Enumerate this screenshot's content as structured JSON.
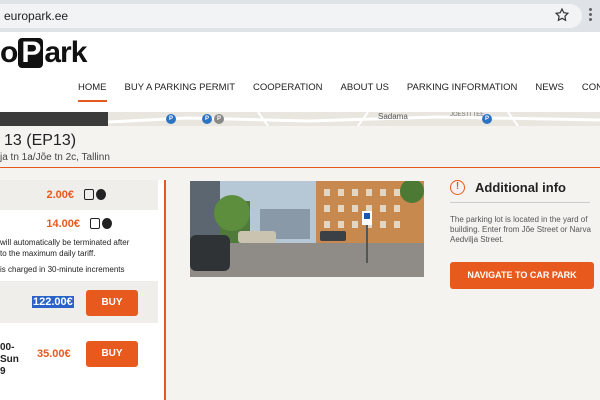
{
  "browser": {
    "url": "europark.ee"
  },
  "header": {
    "logo_text": "oPark",
    "nav": [
      "HOME",
      "BUY A PARKING PERMIT",
      "COOPERATION",
      "ABOUT US",
      "PARKING INFORMATION",
      "NEWS",
      "CONTACT"
    ]
  },
  "map": {
    "street_label": "Sadama",
    "street_label2": "JOESTI TEE",
    "pin_label": "P"
  },
  "lot": {
    "title": "13 (EP13)",
    "address": "ja tn 1a/Jõe tn 2c, Tallinn"
  },
  "prices": {
    "row1": "2.00€",
    "row2": "14.00€",
    "note1": "will automatically be terminated after",
    "note2": "to the maximum daily tariff.",
    "note3": "is charged in 30-minute increments",
    "selected": "122.00€",
    "buy_label": "BUY",
    "night_line1": "00-",
    "night_line2": "Sun",
    "night_line3": "9",
    "night_price": "35.00€"
  },
  "info": {
    "title": "Additional info",
    "icon": "!",
    "desc": "The parking lot is located in the yard of building. Enter from Jõe Street or Narva Aedvilja Street.",
    "button": "NAVIGATE TO CAR PARK"
  },
  "colors": {
    "accent": "#e8591e",
    "selection": "#2a62c9"
  }
}
